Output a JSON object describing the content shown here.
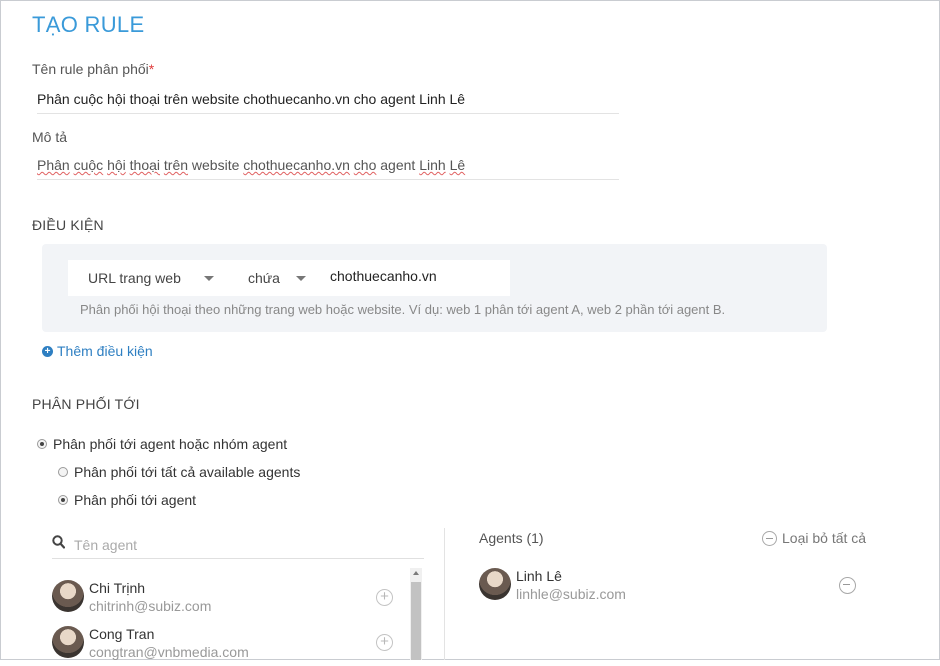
{
  "page": {
    "title": "TẠO RULE"
  },
  "form": {
    "rule_name_label": "Tên rule phân phối",
    "rule_name_required": "*",
    "rule_name_value": "Phân cuộc hội thoại trên website chothuecanho.vn cho agent Linh Lê",
    "description_label": "Mô tả",
    "description_parts": [
      "Phân",
      " ",
      "cuộc",
      " ",
      "hội",
      " ",
      "thoại",
      " ",
      "trên",
      " website ",
      "chothuecanho.vn",
      " ",
      "cho",
      " agent ",
      "Linh",
      " ",
      "Lê"
    ]
  },
  "conditions": {
    "section_title": "ĐIỀU KIỆN",
    "field_select": "URL trang web",
    "operator_select": "chứa",
    "value": "chothuecanho.vn",
    "hint": "Phân phối hội thoại theo những trang web hoặc website. Ví dụ: web 1 phân tới agent A, web 2 phần tới agent B.",
    "add_condition": "Thêm điều kiện"
  },
  "distribution": {
    "section_title": "PHÂN PHỐI TỚI",
    "option_main": "Phân phối tới agent hoặc nhóm agent",
    "option_all": "Phân phối tới tất cả available agents",
    "option_agent": "Phân phối tới agent"
  },
  "agent_picker": {
    "search_placeholder": "Tên agent",
    "available": [
      {
        "name": "Chi Trịnh",
        "email": "chitrinh@subiz.com"
      },
      {
        "name": "Cong Tran",
        "email": "congtran@vnbmedia.com"
      }
    ],
    "selected_title": "Agents (1)",
    "remove_all": "Loại bỏ tất cả",
    "selected": [
      {
        "name": "Linh Lê",
        "email": "linhle@subiz.com"
      }
    ]
  }
}
